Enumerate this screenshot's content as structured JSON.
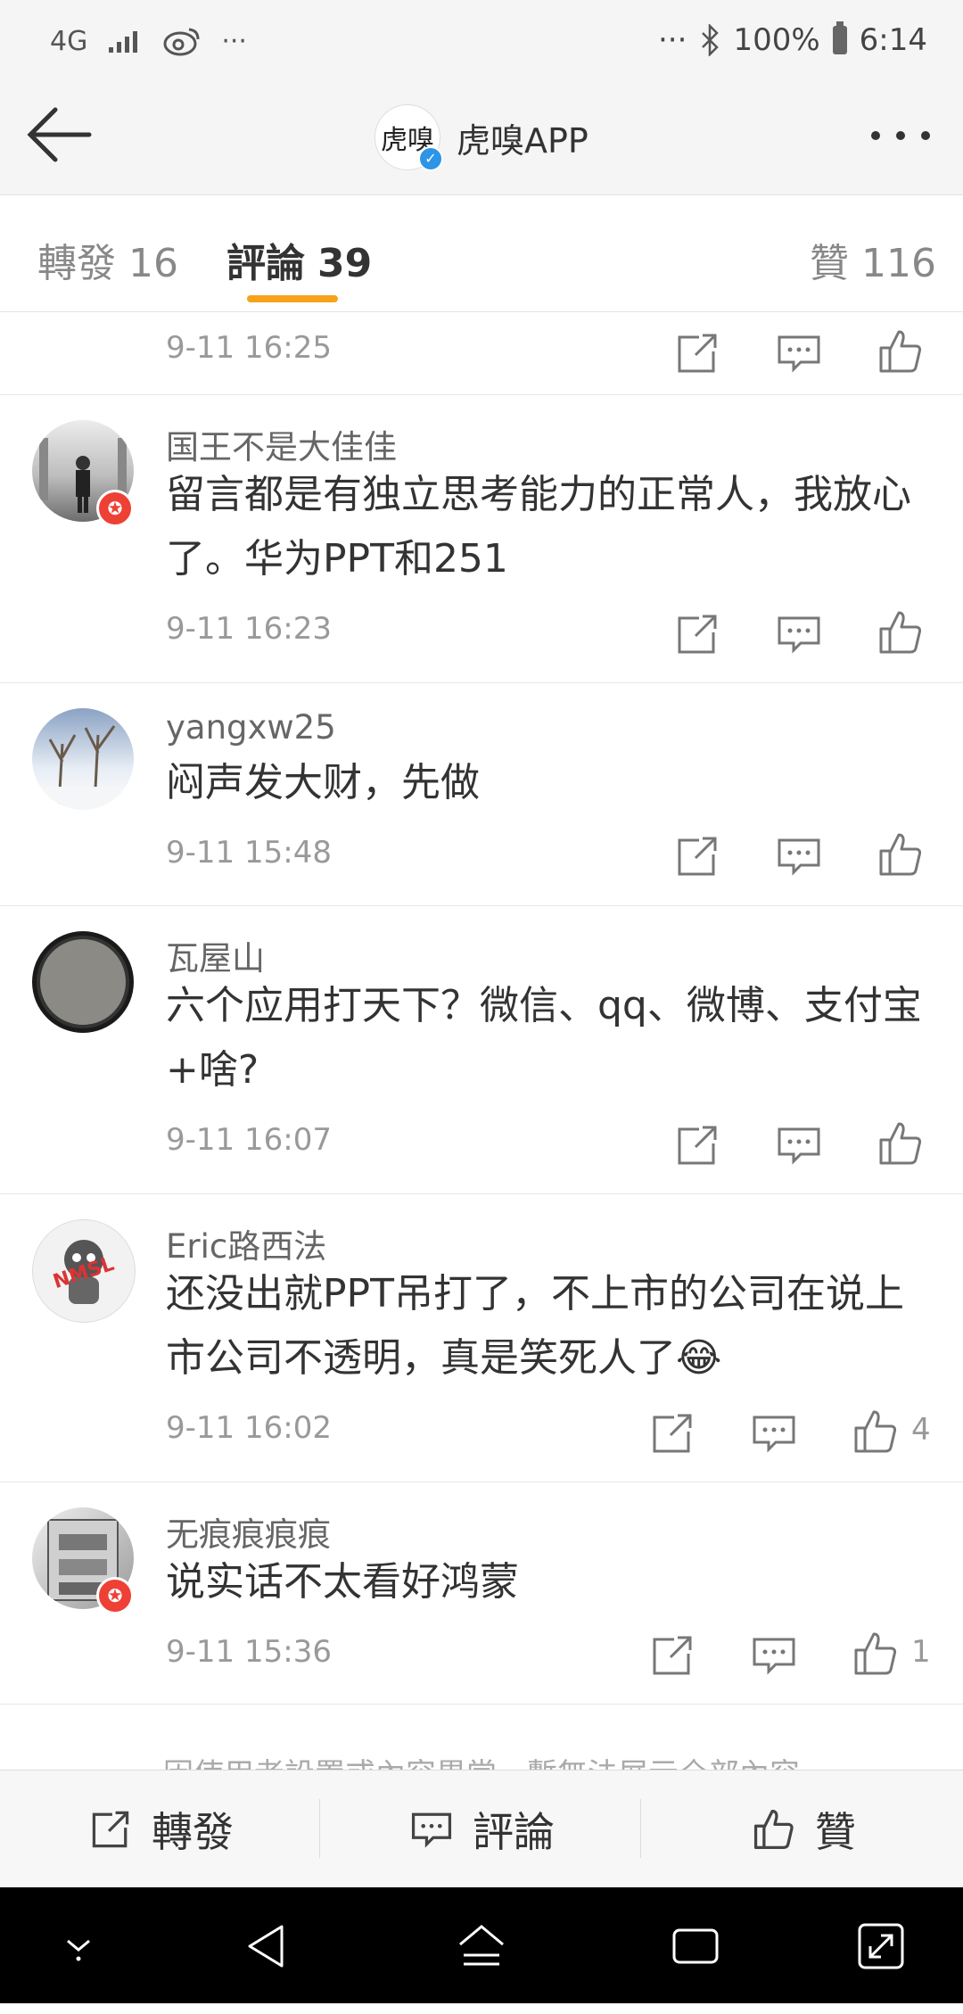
{
  "status_bar": {
    "network": "4G",
    "battery": "100%",
    "time": "6:14",
    "left_more": "···",
    "right_more": "···"
  },
  "header": {
    "logo_text": "虎嗅",
    "title": "虎嗅APP"
  },
  "tabs": [
    {
      "label": "轉發",
      "count": "16"
    },
    {
      "label": "評論",
      "count": "39"
    },
    {
      "label": "贊",
      "count": "116"
    }
  ],
  "comments": [
    {
      "user": "",
      "text": "",
      "time": "9-11 16:25",
      "likes": ""
    },
    {
      "user": "国王不是大佳佳",
      "text": "留言都是有独立思考能力的正常人，我放心了。华为PPT和251",
      "time": "9-11 16:23",
      "likes": ""
    },
    {
      "user": "yangxw25",
      "text": "闷声发大财，先做",
      "time": "9-11 15:48",
      "likes": ""
    },
    {
      "user": "瓦屋山",
      "text": "六个应用打天下？微信、qq、微博、支付宝+啥?",
      "time": "9-11 16:07",
      "likes": ""
    },
    {
      "user": "Eric路西法",
      "text": "还没出就PPT吊打了，不上市的公司在说上市公司不透明，真是笑死人了😂",
      "time": "9-11 16:02",
      "likes": "4"
    },
    {
      "user": "无痕痕痕痕",
      "text": "说实话不太看好鸿蒙",
      "time": "9-11 15:36",
      "likes": "1"
    }
  ],
  "notice": "因使用者設置或內容異常，暫無法展示全部內容",
  "bottom_bar": {
    "repost": "轉發",
    "comment": "評論",
    "like": "贊"
  },
  "colors": {
    "accent": "#f7a21b",
    "verified": "#2c95e8",
    "badge": "#ee4035"
  }
}
